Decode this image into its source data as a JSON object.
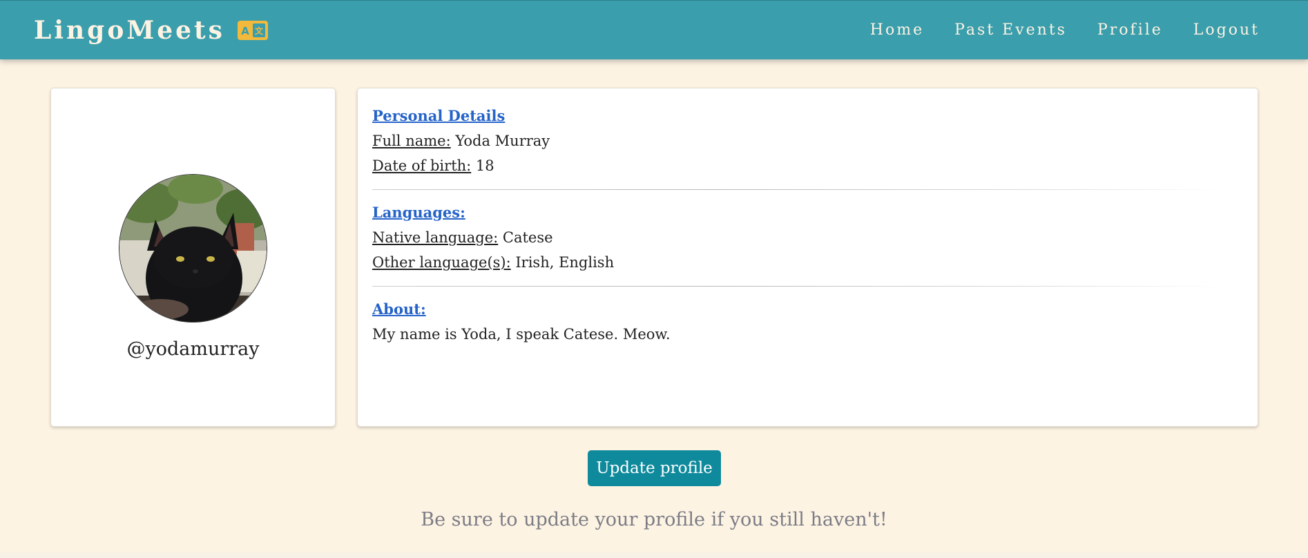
{
  "navbar": {
    "brand": "LingoMeets",
    "brand_icon": "translate-icon",
    "brand_icon_color": "#f2b93b",
    "background": "#3b9eac",
    "links": [
      {
        "label": "Home"
      },
      {
        "label": "Past Events"
      },
      {
        "label": "Profile"
      },
      {
        "label": "Logout"
      }
    ]
  },
  "profile": {
    "avatar": "cat-photo",
    "username": "@yodamurray"
  },
  "details": {
    "personal_title": "Personal Details",
    "full_name_label": "Full name:",
    "full_name": "Yoda Murray",
    "dob_label": "Date of birth:",
    "dob": "18",
    "languages_title": "Languages:",
    "native_label": "Native language:",
    "native": "Catese",
    "other_label": "Other language(s):",
    "other": "Irish, English",
    "about_title": "About:",
    "about": "My name is Yoda, I speak Catese. Meow."
  },
  "actions": {
    "update_label": "Update profile",
    "update_color": "#0f8a9c"
  },
  "hint": "Be sure to update your profile if you still haven't!"
}
